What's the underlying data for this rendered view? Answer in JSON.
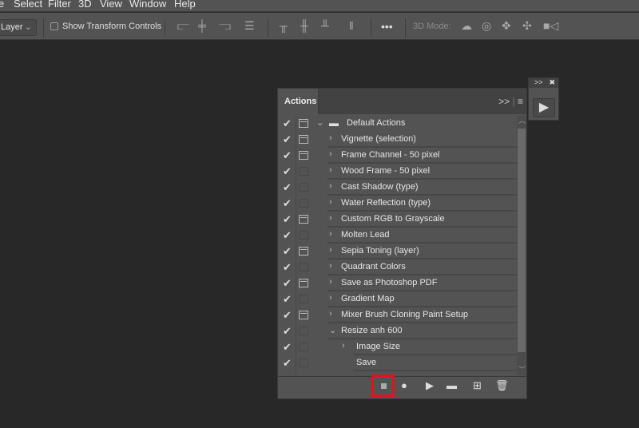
{
  "menu": [
    "e",
    "Select",
    "Filter",
    "3D",
    "View",
    "Window",
    "Help"
  ],
  "options": {
    "layer_select": "Layer",
    "show_transform": "Show Transform Controls",
    "more": "•••",
    "mode_label": "3D Mode:"
  },
  "panel": {
    "tab": "Actions",
    "expand": ">>",
    "menu": "≡",
    "rows": [
      {
        "name": "Default Actions",
        "check": "✔",
        "dialog": true,
        "level": 0,
        "arrow": "⌄",
        "folder": true
      },
      {
        "name": "Vignette (selection)",
        "check": "✔",
        "dialog": true,
        "level": 1,
        "arrow": "›"
      },
      {
        "name": "Frame Channel - 50 pixel",
        "check": "✔",
        "dialog": true,
        "level": 1,
        "arrow": "›"
      },
      {
        "name": "Wood Frame - 50 pixel",
        "check": "✔",
        "dialog": false,
        "level": 1,
        "arrow": "›"
      },
      {
        "name": "Cast Shadow (type)",
        "check": "✔",
        "dialog": false,
        "level": 1,
        "arrow": "›"
      },
      {
        "name": "Water Reflection (type)",
        "check": "✔",
        "dialog": false,
        "level": 1,
        "arrow": "›"
      },
      {
        "name": "Custom RGB to Grayscale",
        "check": "✔",
        "dialog": true,
        "level": 1,
        "arrow": "›"
      },
      {
        "name": "Molten Lead",
        "check": "✔",
        "dialog": false,
        "level": 1,
        "arrow": "›"
      },
      {
        "name": "Sepia Toning (layer)",
        "check": "✔",
        "dialog": true,
        "level": 1,
        "arrow": "›"
      },
      {
        "name": "Quadrant Colors",
        "check": "✔",
        "dialog": false,
        "level": 1,
        "arrow": "›"
      },
      {
        "name": "Save as Photoshop PDF",
        "check": "✔",
        "dialog": true,
        "level": 1,
        "arrow": "›"
      },
      {
        "name": "Gradient Map",
        "check": "✔",
        "dialog": false,
        "level": 1,
        "arrow": "›"
      },
      {
        "name": "Mixer Brush Cloning Paint Setup",
        "check": "✔",
        "dialog": true,
        "level": 1,
        "arrow": "›"
      },
      {
        "name": "Resize anh 600",
        "check": "✔",
        "dialog": false,
        "level": 1,
        "arrow": "⌄"
      },
      {
        "name": "Image Size",
        "check": "✔",
        "dialog": false,
        "level": 2,
        "arrow": "›"
      },
      {
        "name": "Save",
        "check": "✔",
        "dialog": false,
        "level": 2,
        "arrow": ""
      }
    ],
    "highlight_color": "#e0141c"
  },
  "mini": {
    "expand": ">>",
    "close": "✖",
    "play": "▶"
  }
}
